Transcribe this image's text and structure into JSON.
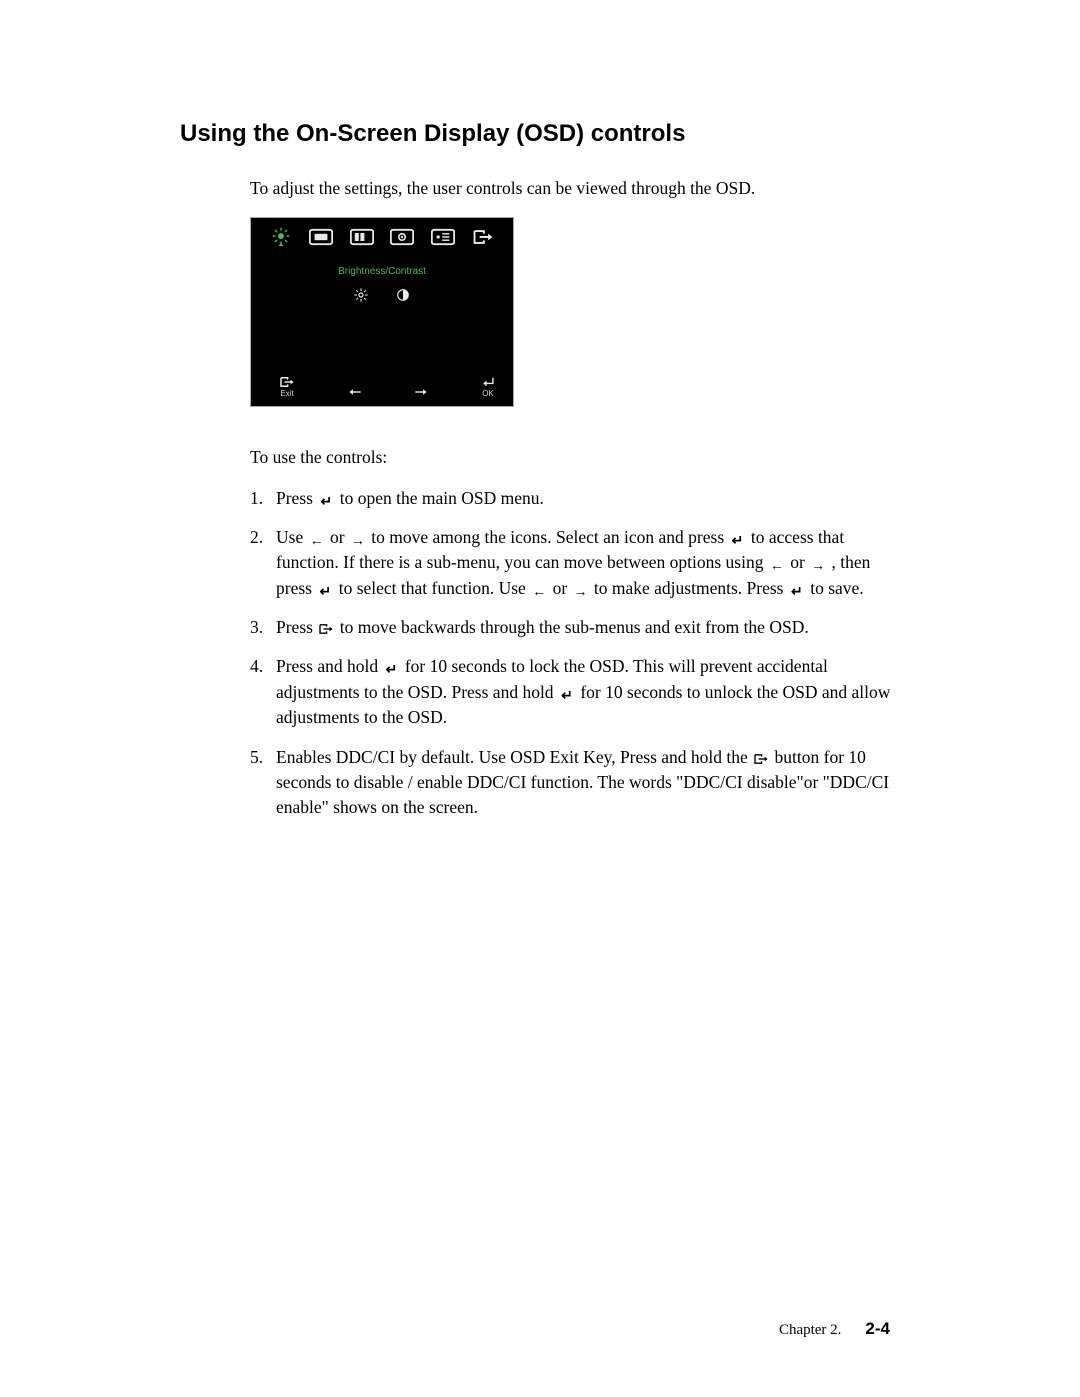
{
  "heading": "Using the On-Screen Display (OSD) controls",
  "intro": "To adjust the settings, the user controls can be viewed through the OSD.",
  "osd": {
    "label": "Brightness/Contrast",
    "exit_label": "Exit",
    "ok_label": "OK"
  },
  "subhead": "To use the controls:",
  "steps": {
    "s1a": "Press ",
    "s1b": " to open the main OSD menu.",
    "s2a": "Use ",
    "s2b": " or ",
    "s2c": " to move among the icons. Select an icon and press ",
    "s2d": " to access that function. If there is a sub-menu, you can move between options using ",
    "s2e": " or ",
    "s2f": " , then press ",
    "s2g": " to select that function. Use ",
    "s2h": " or ",
    "s2i": " to make adjustments. Press ",
    "s2j": " to save.",
    "s3a": "Press  ",
    "s3b": " to move backwards through the sub-menus and exit from the OSD.",
    "s4a": "Press and hold ",
    "s4b": " for 10 seconds to lock the OSD. This will prevent accidental adjustments to the OSD. Press and hold ",
    "s4c": " for 10  seconds to unlock the OSD and allow adjustments to the OSD.",
    "s5a": "Enables DDC/CI by default. Use OSD Exit Key, Press and hold the ",
    "s5b": " button for 10 seconds to disable / enable DDC/CI function. The words \"DDC/CI disable\"or \"DDC/CI enable\" shows on the screen."
  },
  "footer": {
    "chapter": "Chapter 2.",
    "page": "2-4"
  }
}
